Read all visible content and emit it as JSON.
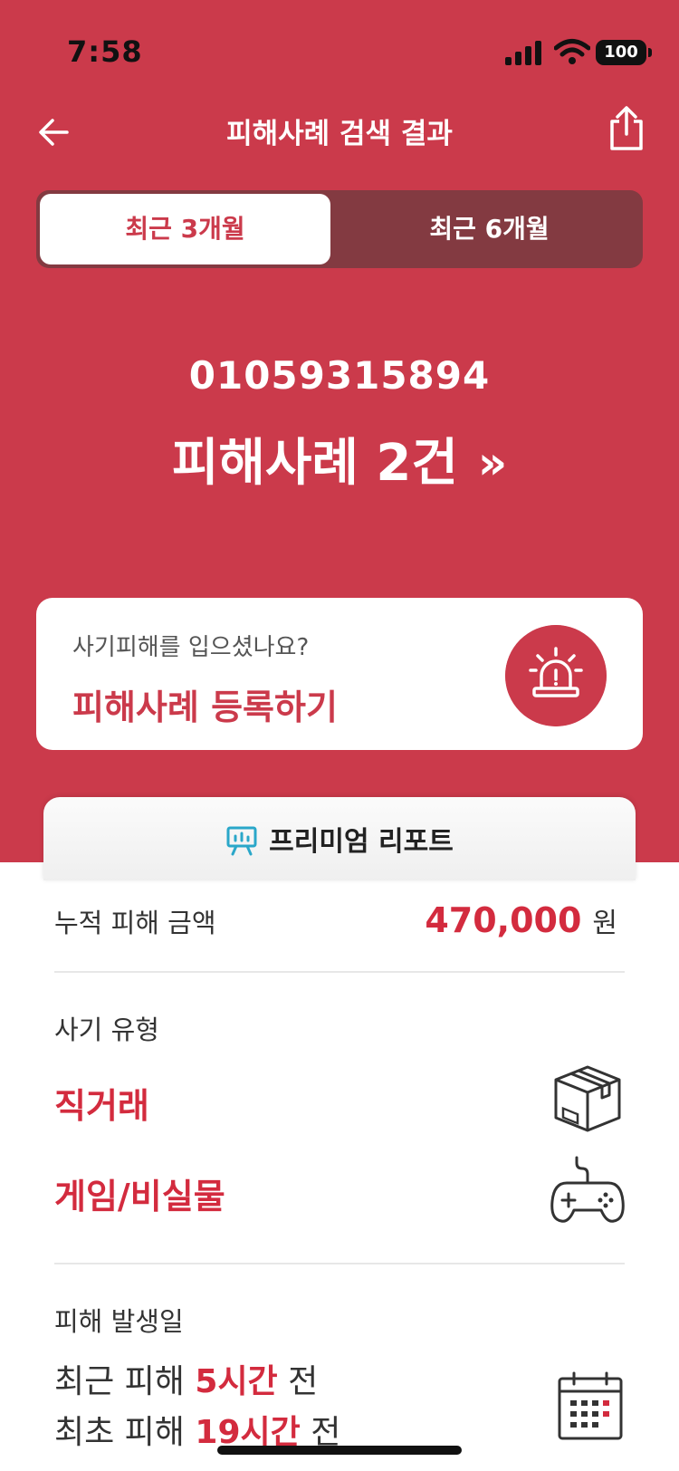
{
  "status_bar": {
    "time": "7:58",
    "battery": "100"
  },
  "nav": {
    "title": "피해사례 검색 결과"
  },
  "segmented": {
    "options": [
      "최근 3개월",
      "최근 6개월"
    ],
    "selected": "최근 3개월"
  },
  "result": {
    "phone_number": "01059315894",
    "count_text": "피해사례 2건",
    "more_glyph": "»"
  },
  "report_card": {
    "question": "사기피해를 입으셨나요?",
    "cta": "피해사례 등록하기"
  },
  "premium_tab": {
    "label": "프리미엄 리포트"
  },
  "details": {
    "damage_amount": {
      "label": "누적 피해 금액",
      "value": "470,000",
      "unit": "원"
    },
    "fraud_type": {
      "label": "사기 유형",
      "items": [
        {
          "name": "직거래",
          "icon": "box-icon"
        },
        {
          "name": "게임/비실물",
          "icon": "gamepad-icon"
        }
      ]
    },
    "occurrence": {
      "label": "피해 발생일",
      "recent_prefix": "최근 피해",
      "recent_value": "5시간",
      "recent_suffix": "전",
      "first_prefix": "최초 피해",
      "first_value": "19시간",
      "first_suffix": "전"
    }
  },
  "colors": {
    "brand_red": "#cb3a4b",
    "segment_dark": "#833a41",
    "amount_red": "#d32b3e"
  }
}
